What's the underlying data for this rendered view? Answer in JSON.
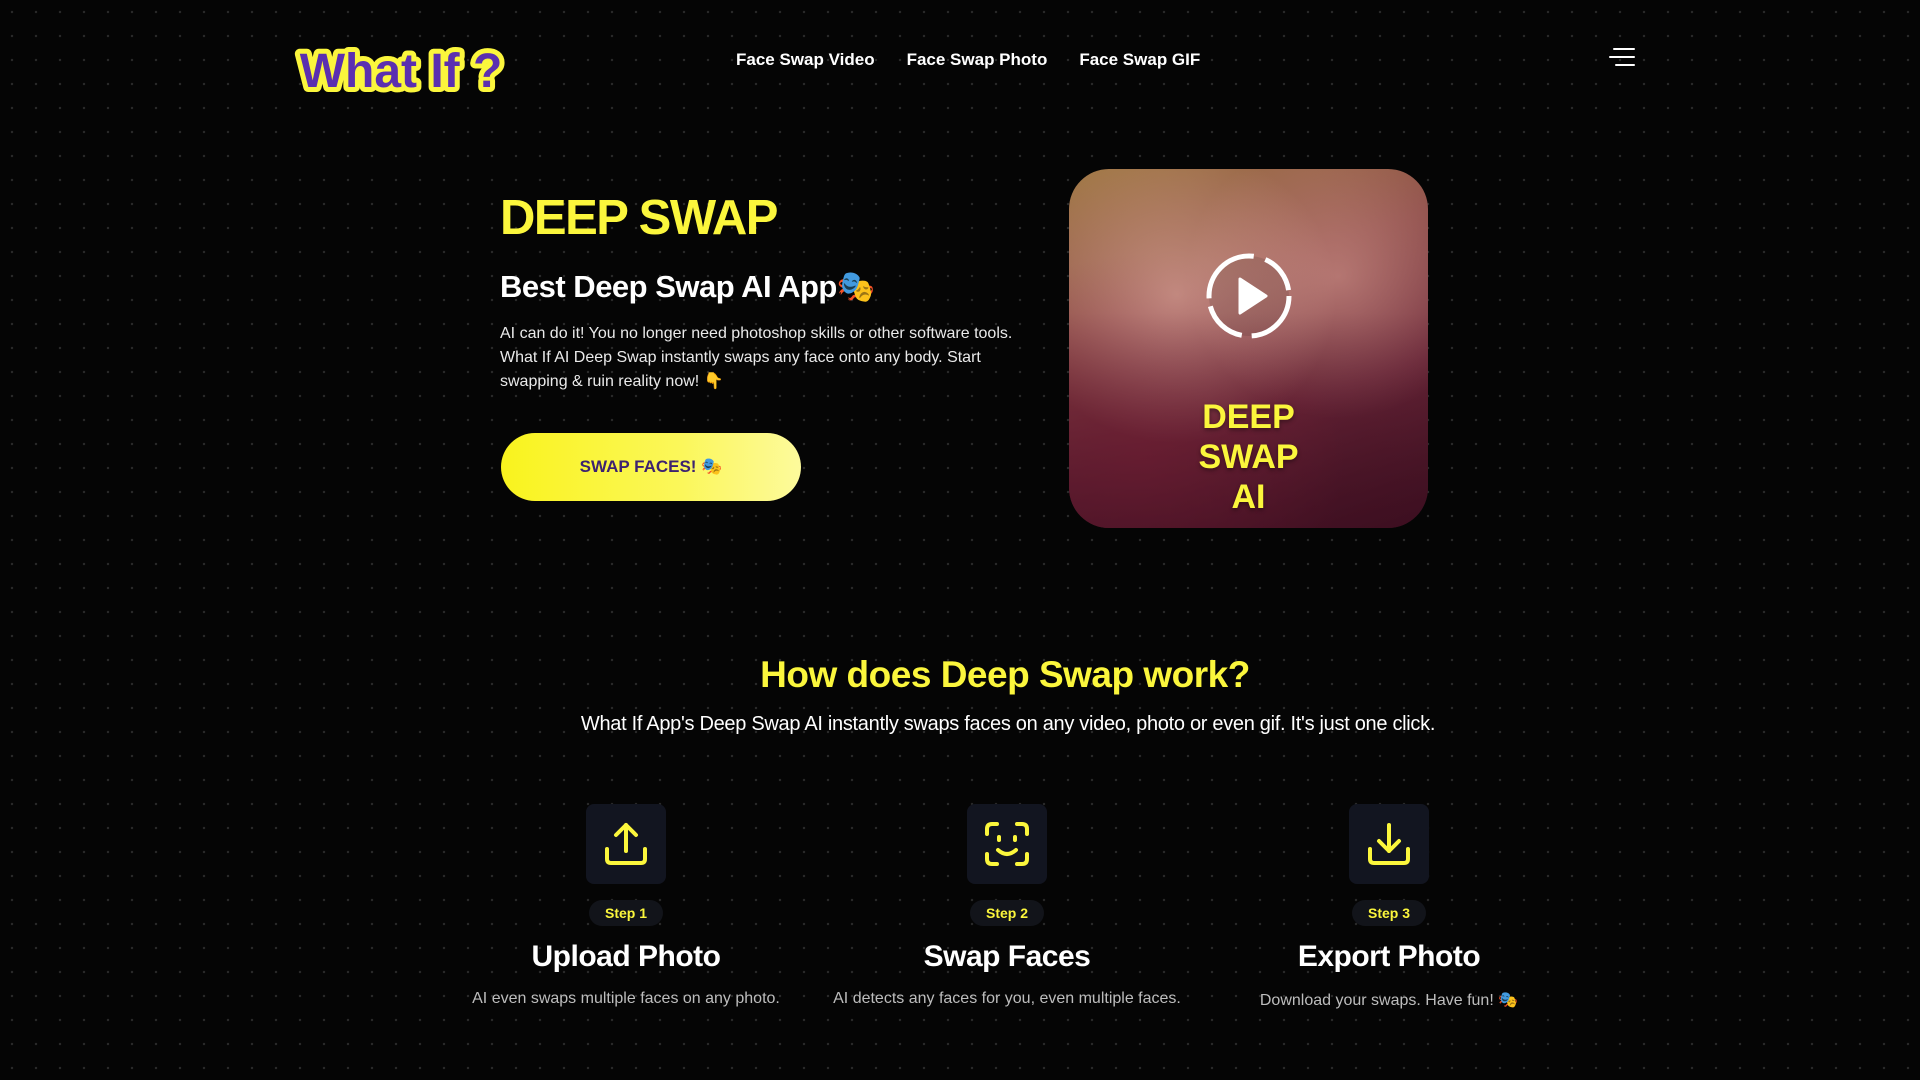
{
  "brand": {
    "logo_text": "What If ?",
    "logo_fill": "#5b2fb0",
    "logo_outline": "#fbf63c"
  },
  "nav": {
    "items": [
      {
        "label": "Face Swap Video"
      },
      {
        "label": "Face Swap Photo"
      },
      {
        "label": "Face Swap GIF"
      }
    ],
    "menu_icon": "hamburger-menu-icon"
  },
  "hero": {
    "title": "DEEP SWAP",
    "subtitle": "Best Deep Swap AI App🎭",
    "description": "AI can do it! You no longer need photoshop skills or other software tools. What If AI Deep Swap instantly swaps any face onto any body. Start swapping & ruin reality now! 👇",
    "cta_label": "SWAP FACES! 🎭",
    "accent": "#fbf63c"
  },
  "video": {
    "overlay_lines": [
      "DEEP",
      "SWAP",
      "AI"
    ],
    "play_icon": "play-circle-icon"
  },
  "how": {
    "title": "How does Deep Swap work?",
    "subtitle": "What If App's Deep Swap AI instantly swaps faces on any video, photo or even gif. It's just one click."
  },
  "steps": [
    {
      "badge": "Step 1",
      "title": "Upload Photo",
      "description": "AI even swaps multiple faces on any photo.",
      "icon": "upload-icon"
    },
    {
      "badge": "Step 2",
      "title": "Swap Faces",
      "description": "AI detects any faces for you, even multiple faces.",
      "icon": "face-scan-icon"
    },
    {
      "badge": "Step 3",
      "title": "Export Photo",
      "description": "Download your swaps. Have fun! 🎭",
      "icon": "download-icon"
    }
  ]
}
